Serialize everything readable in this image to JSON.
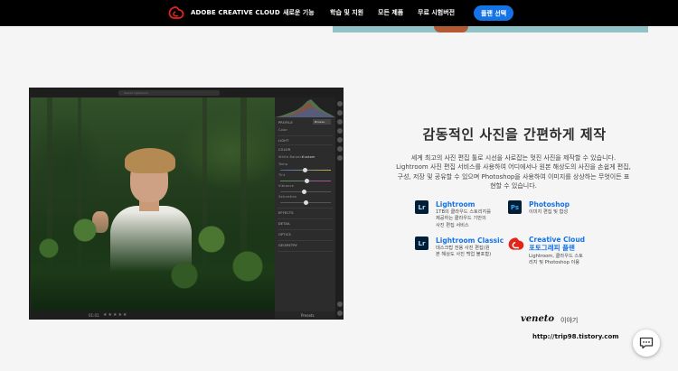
{
  "nav": {
    "brand": "ADOBE CREATIVE CLOUD",
    "items": [
      "새로운 기능",
      "학습 및 지원",
      "모든 제품",
      "무료 시험버전"
    ],
    "cta": "플랜 선택"
  },
  "app_ui": {
    "search_placeholder": "Search Lightroom",
    "panel": {
      "profile_label": "PROFILE",
      "profile_value": "Browse",
      "color_value": "Color",
      "light_label": "LIGHT",
      "color_label": "COLOR",
      "wb_label": "White Balance",
      "wb_value": "Custom",
      "temp_label": "Temp",
      "tint_label": "Tint",
      "vibrance_label": "Vibrance",
      "saturation_label": "Saturation",
      "effects_label": "EFFECTS",
      "detail_label": "DETAIL",
      "optics_label": "OPTICS",
      "geometry_label": "GEOMETRY"
    },
    "bottom": {
      "zoom": "01:01",
      "stars": "★★★★★",
      "presets": "Presets"
    }
  },
  "content": {
    "heading": "감동적인 사진을 간편하게 제작",
    "description": "세계 최고의 사진 편집 툴로 시선을 사로잡는 멋진 사진을 제작할 수 있습니다. Lightroom 사진 편집 서비스를 사용하여 어디에서나 원본 해상도의 사진을 손쉽게 편집, 구성, 저장 및 공유할 수 있으며 Photoshop을 사용하여 이미지를 상상하는 무엇이든 표현할 수 있습니다.",
    "features": [
      {
        "icon": "Lr",
        "title": "Lightroom",
        "lines": [
          "1TB의 클라우드 스토리지를",
          "제공하는 클라우드 기반의",
          "사진 편집 서비스"
        ]
      },
      {
        "icon": "Ps",
        "title": "Photoshop",
        "lines": [
          "이미지 편집 및 합성"
        ]
      },
      {
        "icon": "Lr",
        "title": "Lightroom Classic",
        "lines": [
          "데스크탑 전용 사진 편집(원",
          "본 해상도 사진 백업 불포함)"
        ]
      },
      {
        "icon": "cc",
        "title": "Creative Cloud 포토그래피 플랜",
        "lines": [
          "Lightroom, 클라우드 스토",
          "리지 및 Photoshop 이용"
        ]
      }
    ]
  },
  "watermark": {
    "name": "veneto",
    "korean": "이야기",
    "url": "http://trip98.tistory.com"
  },
  "colors": {
    "accent": "#1473e6",
    "nav_bg": "#000000",
    "page_bg": "#f5f5f5",
    "adobe_red": "#e1251b"
  }
}
